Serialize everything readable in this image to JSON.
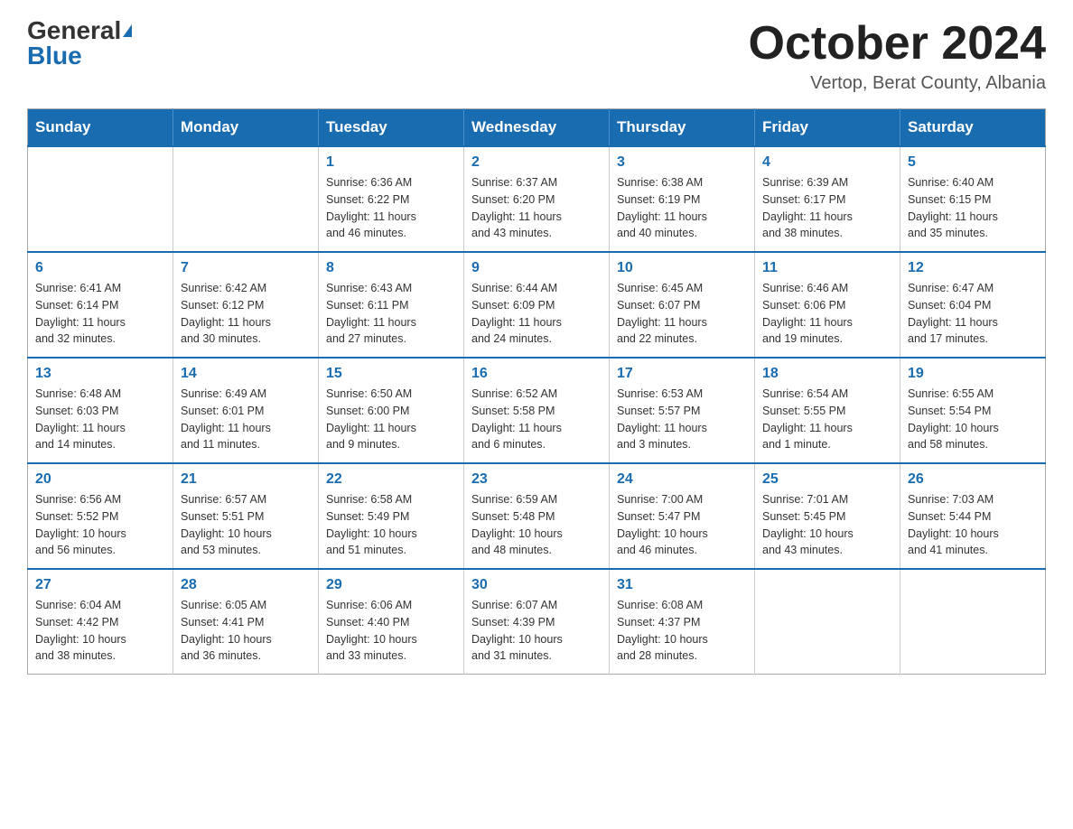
{
  "header": {
    "logo_general": "General",
    "logo_blue": "Blue",
    "title": "October 2024",
    "location": "Vertop, Berat County, Albania"
  },
  "calendar": {
    "days_of_week": [
      "Sunday",
      "Monday",
      "Tuesday",
      "Wednesday",
      "Thursday",
      "Friday",
      "Saturday"
    ],
    "weeks": [
      [
        {
          "day": "",
          "info": ""
        },
        {
          "day": "",
          "info": ""
        },
        {
          "day": "1",
          "info": "Sunrise: 6:36 AM\nSunset: 6:22 PM\nDaylight: 11 hours\nand 46 minutes."
        },
        {
          "day": "2",
          "info": "Sunrise: 6:37 AM\nSunset: 6:20 PM\nDaylight: 11 hours\nand 43 minutes."
        },
        {
          "day": "3",
          "info": "Sunrise: 6:38 AM\nSunset: 6:19 PM\nDaylight: 11 hours\nand 40 minutes."
        },
        {
          "day": "4",
          "info": "Sunrise: 6:39 AM\nSunset: 6:17 PM\nDaylight: 11 hours\nand 38 minutes."
        },
        {
          "day": "5",
          "info": "Sunrise: 6:40 AM\nSunset: 6:15 PM\nDaylight: 11 hours\nand 35 minutes."
        }
      ],
      [
        {
          "day": "6",
          "info": "Sunrise: 6:41 AM\nSunset: 6:14 PM\nDaylight: 11 hours\nand 32 minutes."
        },
        {
          "day": "7",
          "info": "Sunrise: 6:42 AM\nSunset: 6:12 PM\nDaylight: 11 hours\nand 30 minutes."
        },
        {
          "day": "8",
          "info": "Sunrise: 6:43 AM\nSunset: 6:11 PM\nDaylight: 11 hours\nand 27 minutes."
        },
        {
          "day": "9",
          "info": "Sunrise: 6:44 AM\nSunset: 6:09 PM\nDaylight: 11 hours\nand 24 minutes."
        },
        {
          "day": "10",
          "info": "Sunrise: 6:45 AM\nSunset: 6:07 PM\nDaylight: 11 hours\nand 22 minutes."
        },
        {
          "day": "11",
          "info": "Sunrise: 6:46 AM\nSunset: 6:06 PM\nDaylight: 11 hours\nand 19 minutes."
        },
        {
          "day": "12",
          "info": "Sunrise: 6:47 AM\nSunset: 6:04 PM\nDaylight: 11 hours\nand 17 minutes."
        }
      ],
      [
        {
          "day": "13",
          "info": "Sunrise: 6:48 AM\nSunset: 6:03 PM\nDaylight: 11 hours\nand 14 minutes."
        },
        {
          "day": "14",
          "info": "Sunrise: 6:49 AM\nSunset: 6:01 PM\nDaylight: 11 hours\nand 11 minutes."
        },
        {
          "day": "15",
          "info": "Sunrise: 6:50 AM\nSunset: 6:00 PM\nDaylight: 11 hours\nand 9 minutes."
        },
        {
          "day": "16",
          "info": "Sunrise: 6:52 AM\nSunset: 5:58 PM\nDaylight: 11 hours\nand 6 minutes."
        },
        {
          "day": "17",
          "info": "Sunrise: 6:53 AM\nSunset: 5:57 PM\nDaylight: 11 hours\nand 3 minutes."
        },
        {
          "day": "18",
          "info": "Sunrise: 6:54 AM\nSunset: 5:55 PM\nDaylight: 11 hours\nand 1 minute."
        },
        {
          "day": "19",
          "info": "Sunrise: 6:55 AM\nSunset: 5:54 PM\nDaylight: 10 hours\nand 58 minutes."
        }
      ],
      [
        {
          "day": "20",
          "info": "Sunrise: 6:56 AM\nSunset: 5:52 PM\nDaylight: 10 hours\nand 56 minutes."
        },
        {
          "day": "21",
          "info": "Sunrise: 6:57 AM\nSunset: 5:51 PM\nDaylight: 10 hours\nand 53 minutes."
        },
        {
          "day": "22",
          "info": "Sunrise: 6:58 AM\nSunset: 5:49 PM\nDaylight: 10 hours\nand 51 minutes."
        },
        {
          "day": "23",
          "info": "Sunrise: 6:59 AM\nSunset: 5:48 PM\nDaylight: 10 hours\nand 48 minutes."
        },
        {
          "day": "24",
          "info": "Sunrise: 7:00 AM\nSunset: 5:47 PM\nDaylight: 10 hours\nand 46 minutes."
        },
        {
          "day": "25",
          "info": "Sunrise: 7:01 AM\nSunset: 5:45 PM\nDaylight: 10 hours\nand 43 minutes."
        },
        {
          "day": "26",
          "info": "Sunrise: 7:03 AM\nSunset: 5:44 PM\nDaylight: 10 hours\nand 41 minutes."
        }
      ],
      [
        {
          "day": "27",
          "info": "Sunrise: 6:04 AM\nSunset: 4:42 PM\nDaylight: 10 hours\nand 38 minutes."
        },
        {
          "day": "28",
          "info": "Sunrise: 6:05 AM\nSunset: 4:41 PM\nDaylight: 10 hours\nand 36 minutes."
        },
        {
          "day": "29",
          "info": "Sunrise: 6:06 AM\nSunset: 4:40 PM\nDaylight: 10 hours\nand 33 minutes."
        },
        {
          "day": "30",
          "info": "Sunrise: 6:07 AM\nSunset: 4:39 PM\nDaylight: 10 hours\nand 31 minutes."
        },
        {
          "day": "31",
          "info": "Sunrise: 6:08 AM\nSunset: 4:37 PM\nDaylight: 10 hours\nand 28 minutes."
        },
        {
          "day": "",
          "info": ""
        },
        {
          "day": "",
          "info": ""
        }
      ]
    ]
  }
}
